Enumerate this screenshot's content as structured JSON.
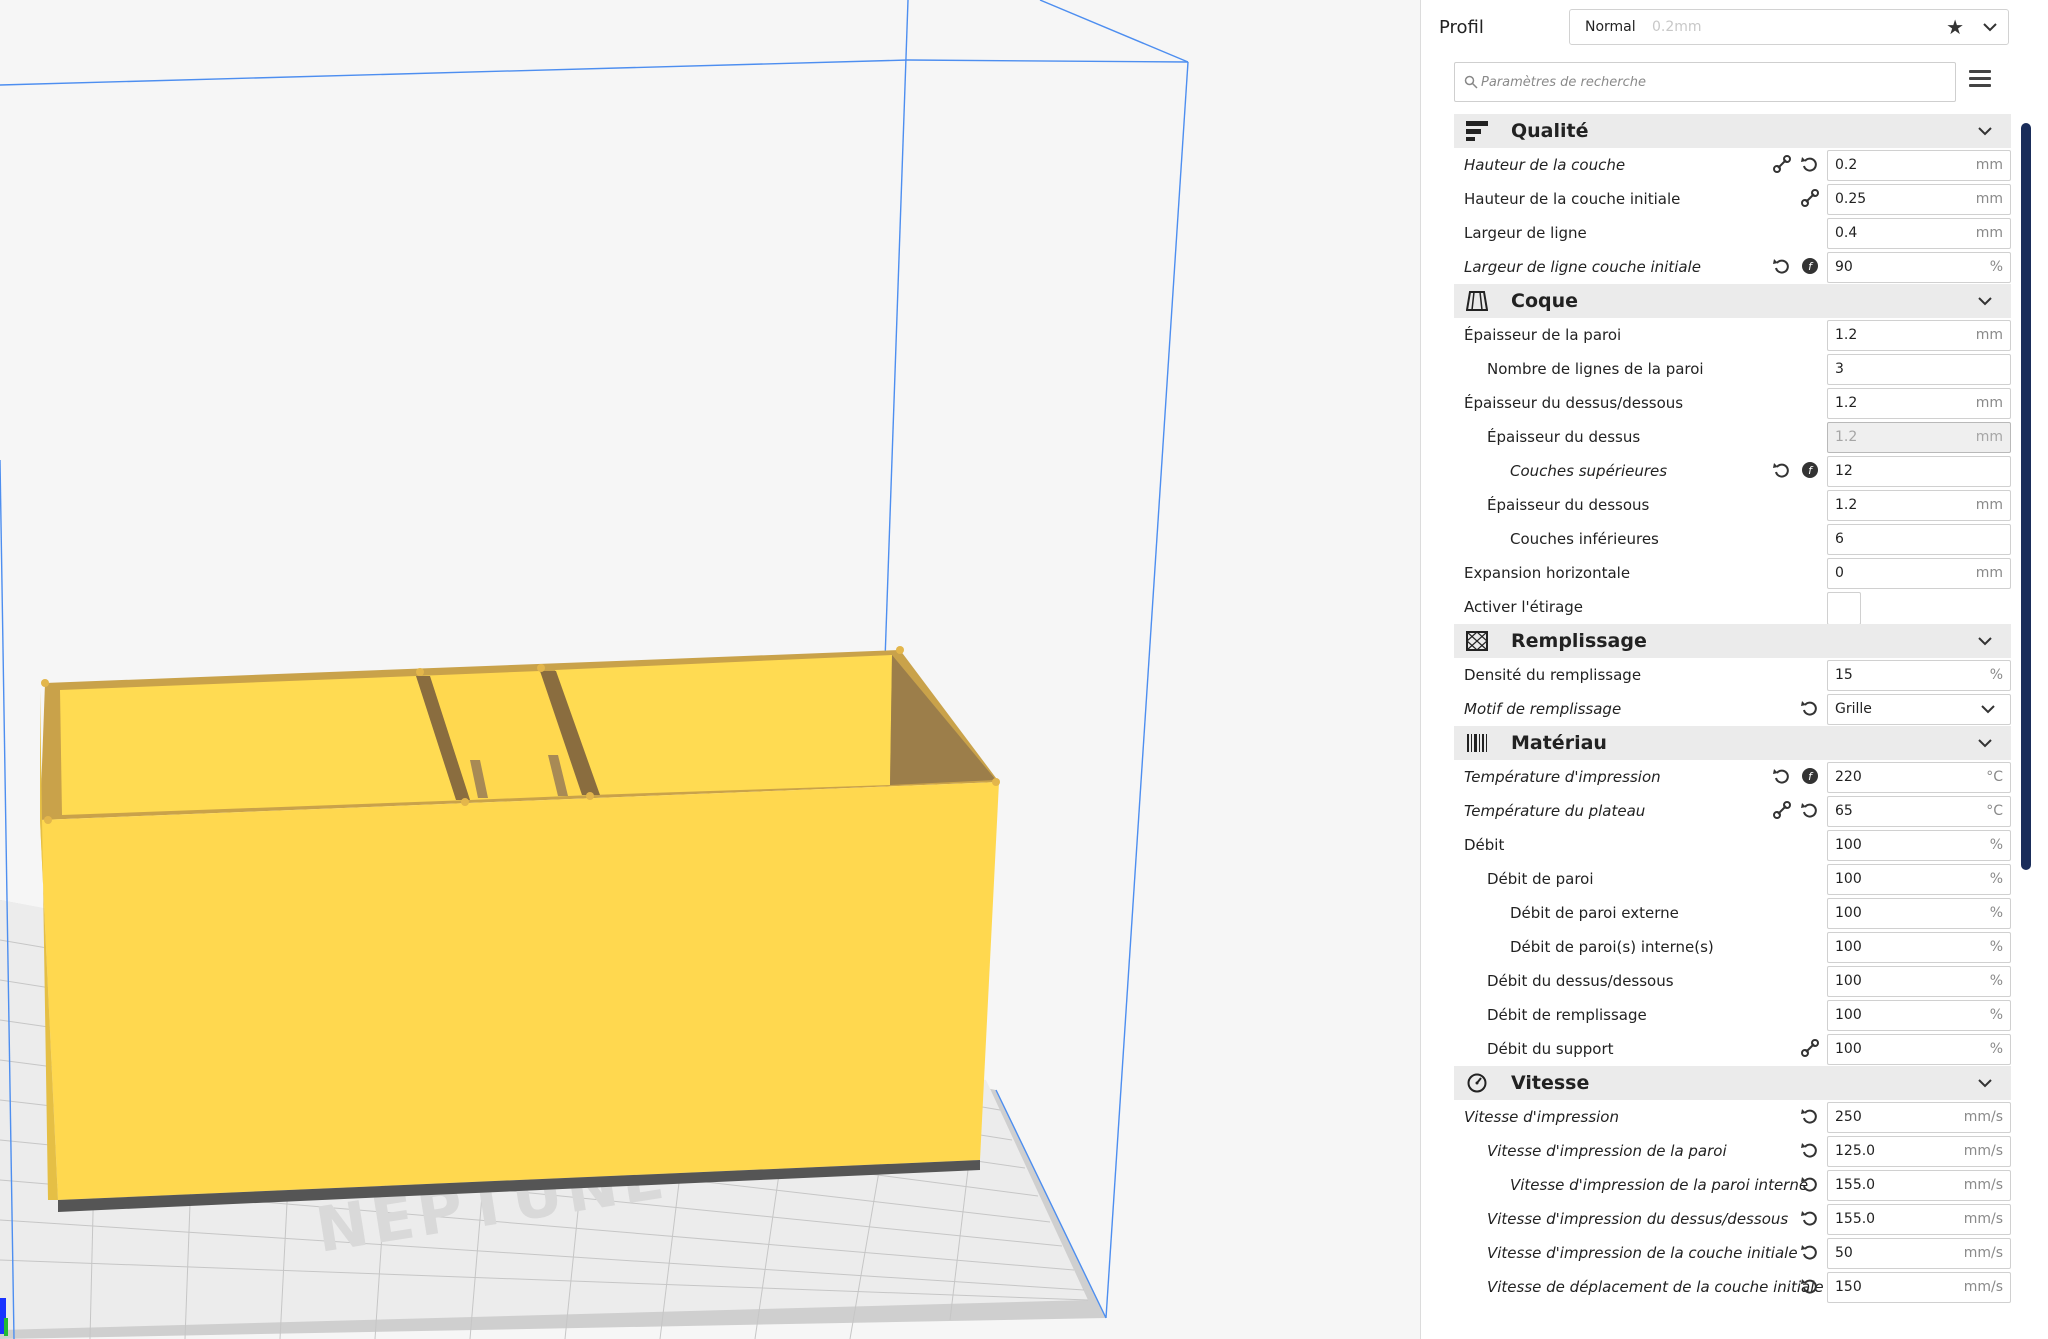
{
  "viewport": {
    "watermark": "NEPTUNE"
  },
  "profile": {
    "label": "Profil",
    "name": "Normal",
    "sub": "0.2mm"
  },
  "search": {
    "placeholder": "Paramètres de recherche"
  },
  "categories": {
    "qualite": {
      "title": "Qualité",
      "icon": "layer-height-icon"
    },
    "coque": {
      "title": "Coque",
      "icon": "shell-icon"
    },
    "remplissage": {
      "title": "Remplissage",
      "icon": "infill-icon"
    },
    "materiau": {
      "title": "Matériau",
      "icon": "material-icon"
    },
    "vitesse": {
      "title": "Vitesse",
      "icon": "speed-icon"
    }
  },
  "settings": [
    {
      "label": "Hauteur de la couche",
      "value": "0.2",
      "unit": "mm"
    },
    {
      "label": "Hauteur de la couche initiale",
      "value": "0.25",
      "unit": "mm"
    },
    {
      "label": "Largeur de ligne",
      "value": "0.4",
      "unit": "mm"
    },
    {
      "label": "Largeur de ligne couche initiale",
      "value": "90",
      "unit": "%"
    },
    {
      "label": "Épaisseur de la paroi",
      "value": "1.2",
      "unit": "mm"
    },
    {
      "label": "Nombre de lignes de la paroi",
      "value": "3",
      "unit": ""
    },
    {
      "label": "Épaisseur du dessus/dessous",
      "value": "1.2",
      "unit": "mm"
    },
    {
      "label": "Épaisseur du dessus",
      "value": "1.2",
      "unit": "mm"
    },
    {
      "label": "Couches supérieures",
      "value": "12",
      "unit": ""
    },
    {
      "label": "Épaisseur du dessous",
      "value": "1.2",
      "unit": "mm"
    },
    {
      "label": "Couches inférieures",
      "value": "6",
      "unit": ""
    },
    {
      "label": "Expansion horizontale",
      "value": "0",
      "unit": "mm"
    },
    {
      "label": "Activer l'étirage",
      "value": "",
      "unit": ""
    },
    {
      "label": "Densité du remplissage",
      "value": "15",
      "unit": "%"
    },
    {
      "label": "Motif de remplissage",
      "value": "Grille",
      "unit": ""
    },
    {
      "label": "Température d'impression",
      "value": "220",
      "unit": "°C"
    },
    {
      "label": "Température du plateau",
      "value": "65",
      "unit": "°C"
    },
    {
      "label": "Débit",
      "value": "100",
      "unit": "%"
    },
    {
      "label": "Débit de paroi",
      "value": "100",
      "unit": "%"
    },
    {
      "label": "Débit de paroi externe",
      "value": "100",
      "unit": "%"
    },
    {
      "label": "Débit de paroi(s) interne(s)",
      "value": "100",
      "unit": "%"
    },
    {
      "label": "Débit du dessus/dessous",
      "value": "100",
      "unit": "%"
    },
    {
      "label": "Débit de remplissage",
      "value": "100",
      "unit": "%"
    },
    {
      "label": "Débit du support",
      "value": "100",
      "unit": "%"
    },
    {
      "label": "Vitesse d'impression",
      "value": "250",
      "unit": "mm/s"
    },
    {
      "label": "Vitesse d'impression de la paroi",
      "value": "125.0",
      "unit": "mm/s"
    },
    {
      "label": "Vitesse d'impression de la paroi interne",
      "value": "155.0",
      "unit": "mm/s"
    },
    {
      "label": "Vitesse d'impression du dessus/dessous",
      "value": "155.0",
      "unit": "mm/s"
    },
    {
      "label": "Vitesse d'impression de la couche initiale",
      "value": "50",
      "unit": "mm/s"
    },
    {
      "label": "Vitesse de déplacement de la couche initiale",
      "value": "150",
      "unit": "mm/s"
    }
  ],
  "colors": {
    "model": "#ffd84f",
    "model_side": "#c9a24a",
    "build_volume": "#4d8ef0",
    "scrollbar": "#1a2d5a"
  }
}
